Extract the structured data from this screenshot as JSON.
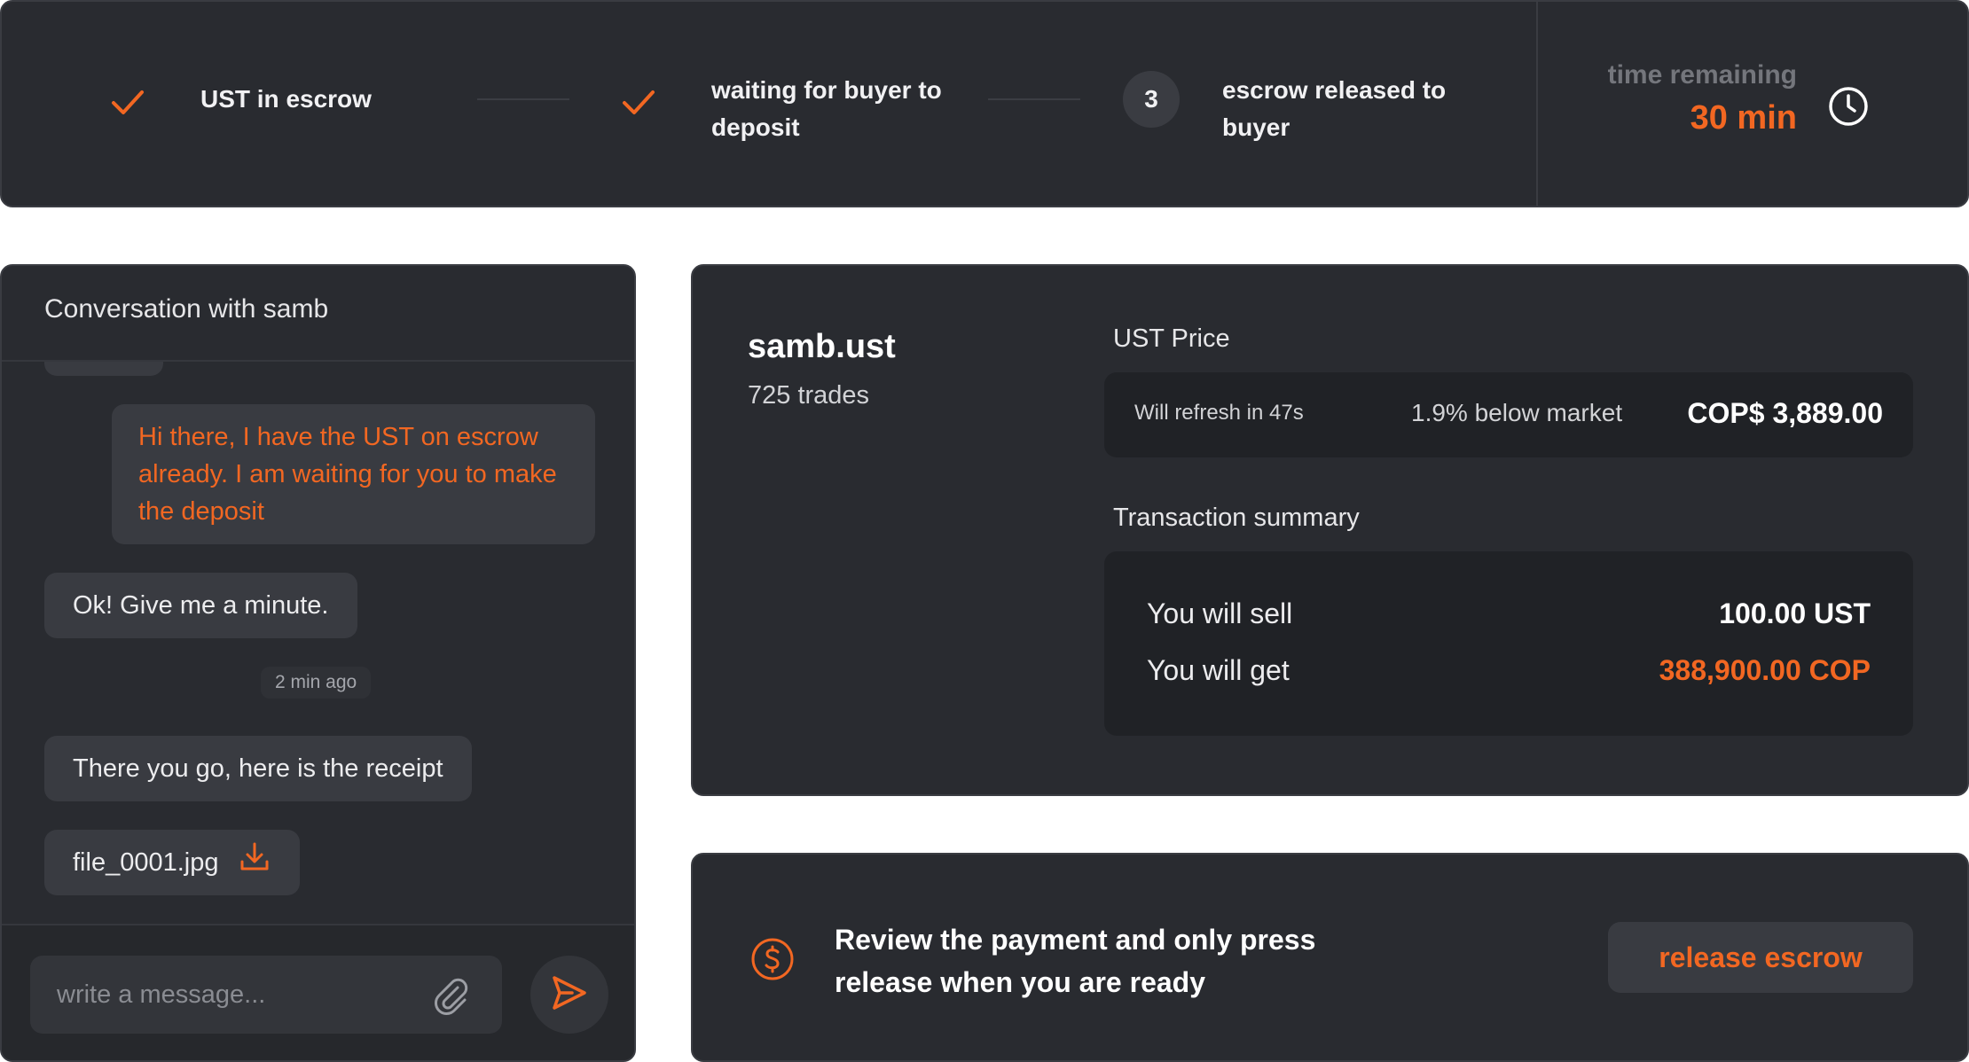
{
  "progress": {
    "steps": [
      {
        "status": "done",
        "label": "UST in escrow"
      },
      {
        "status": "done",
        "label": "waiting for buyer to deposit"
      },
      {
        "status": "pending",
        "number": "3",
        "label": "escrow released to buyer"
      }
    ],
    "time_remaining_label": "time remaining",
    "time_remaining_value": "30 min",
    "icons": {
      "step_done": "check-icon",
      "timer": "clock-icon"
    }
  },
  "chat": {
    "title": "Conversation with samb",
    "messages": [
      {
        "text": "Hi there, I have the UST on escrow already. I am waiting for you to make the deposit"
      },
      {
        "text": "Ok! Give me a minute."
      },
      {
        "text": "There you go, here is the receipt"
      }
    ],
    "timestamp": "2 min ago",
    "attachment": {
      "filename": "file_0001.jpg",
      "icon": "download-icon"
    },
    "input_placeholder": "write a message...",
    "icons": {
      "attach": "paperclip-icon",
      "send": "send-icon"
    }
  },
  "trade": {
    "seller_name": "samb.ust",
    "seller_trades": "725 trades",
    "price_label": "UST Price",
    "refresh_text": "Will refresh in 47s",
    "below_market": "1.9% below market",
    "price_value": "COP$ 3,889.00",
    "summary_label": "Transaction summary",
    "sell_label": "You will sell",
    "sell_value": "100.00 UST",
    "get_label": "You will get",
    "get_value": "388,900.00 COP"
  },
  "release": {
    "message": "Review the payment and only press release when you are ready",
    "button_label": "release escrow",
    "icon": "dollar-circle-icon"
  },
  "colors": {
    "accent": "#f26722",
    "card_bg": "#292b30",
    "bubble_bg": "#393b41",
    "inner_box_bg": "#202226"
  }
}
